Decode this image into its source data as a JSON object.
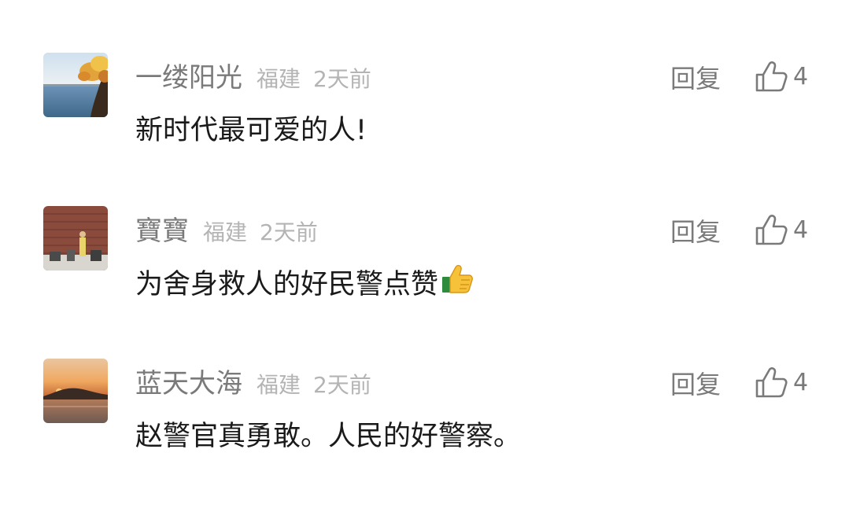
{
  "comments": [
    {
      "username": "一缕阳光",
      "location": "福建",
      "time": "2天前",
      "reply_label": "回复",
      "like_count": "4",
      "text": "新时代最可爱的人!",
      "avatar_icon": "landscape-tree-lake-avatar"
    },
    {
      "username": "寶寶",
      "location": "福建",
      "time": "2天前",
      "reply_label": "回复",
      "like_count": "4",
      "text": "为舍身救人的好民警点赞",
      "emoji_icon": "thumbs-up-emoji",
      "avatar_icon": "brick-wall-stage-avatar"
    },
    {
      "username": "蓝天大海",
      "location": "福建",
      "time": "2天前",
      "reply_label": "回复",
      "like_count": "4",
      "text": "赵警官真勇敢。人民的好警察。",
      "avatar_icon": "sunset-sea-avatar"
    }
  ],
  "colors": {
    "username": "#7a7a7a",
    "meta": "#b4b4b4",
    "text": "#1a1a1a",
    "action": "#7a7a7a"
  }
}
